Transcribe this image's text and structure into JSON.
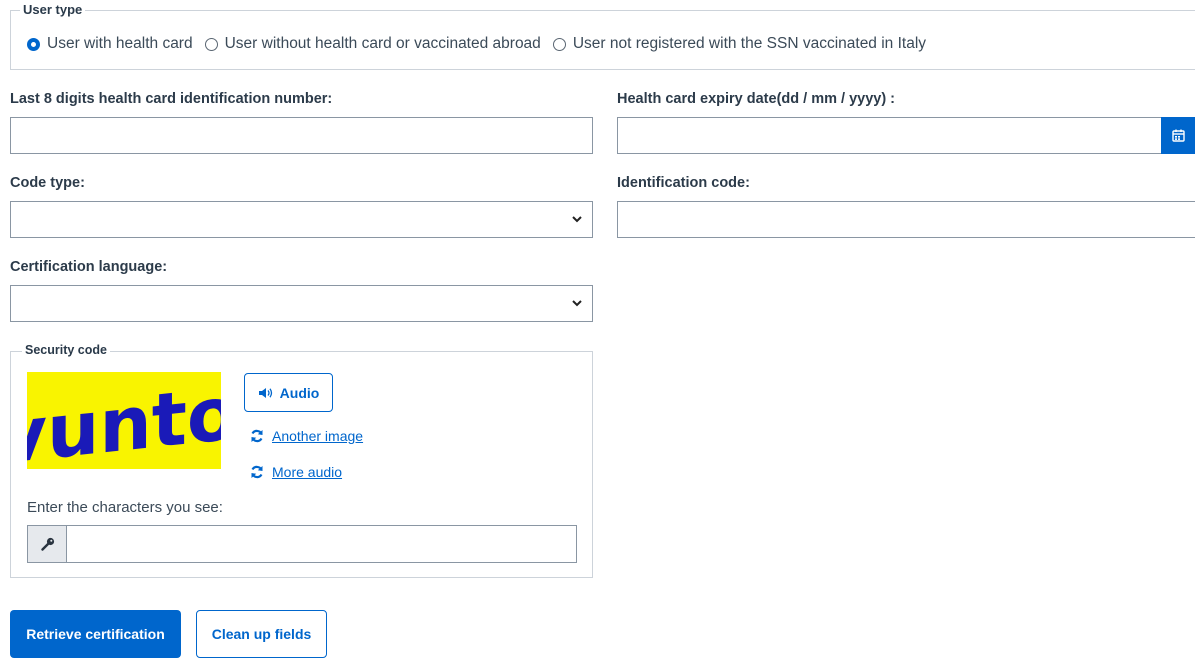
{
  "user_type": {
    "legend": "User type",
    "options": [
      {
        "label": "User with health card",
        "checked": true
      },
      {
        "label": "User without health card or vaccinated abroad",
        "checked": false
      },
      {
        "label": "User not registered with the SSN vaccinated in Italy",
        "checked": false
      }
    ]
  },
  "fields": {
    "card_number_label": "Last 8 digits health card identification number:",
    "card_number_value": "",
    "expiry_label": "Health card expiry date(dd / mm / yyyy) :",
    "expiry_value": "",
    "code_type_label": "Code type:",
    "code_type_value": "",
    "identification_label": "Identification code:",
    "identification_value": "",
    "language_label": "Certification language:",
    "language_value": ""
  },
  "security": {
    "legend": "Security code",
    "captcha_text": "vunto",
    "audio_label": "Audio",
    "another_image_label": "Another image",
    "more_audio_label": "More audio",
    "enter_label": "Enter the characters you see:",
    "input_value": ""
  },
  "actions": {
    "retrieve_label": "Retrieve certification",
    "clear_label": "Clean up fields"
  },
  "colors": {
    "accent": "#0066cc",
    "captcha_bg": "#f9f400",
    "captcha_ink": "#1a1ab8"
  },
  "icons": {
    "calendar": "calendar-icon",
    "chevron": "chevron-down-icon",
    "speaker": "speaker-icon",
    "refresh": "refresh-icon",
    "key": "key-icon"
  }
}
